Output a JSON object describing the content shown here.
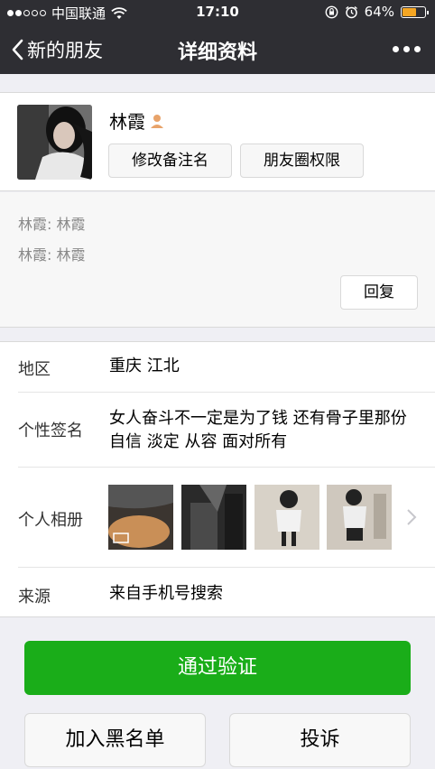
{
  "status_bar": {
    "carrier": "中国联通",
    "time": "17:10",
    "battery_percent_label": "64%",
    "battery_level": 0.64
  },
  "nav": {
    "back_label": "新的朋友",
    "title": "详细资料"
  },
  "profile": {
    "name": "林霞",
    "remark_button": "修改备注名",
    "moments_permission_button": "朋友圈权限"
  },
  "messages": {
    "items": [
      "林霞: 林霞",
      "林霞: 林霞"
    ],
    "reply_button": "回复"
  },
  "info": {
    "region_label": "地区",
    "region_value": "重庆  江北",
    "signature_label": "个性签名",
    "signature_value": "女人奋斗不一定是为了钱 还有骨子里那份自信 淡定 从容 面对所有",
    "album_label": "个人相册",
    "source_label": "来源",
    "source_value": "来自手机号搜索"
  },
  "actions": {
    "verify_button": "通过验证",
    "blacklist_button": "加入黑名单",
    "report_button": "投诉"
  },
  "colors": {
    "nav_bg": "#2e2e33",
    "accent_green": "#1aad19",
    "battery": "#f5a623"
  }
}
